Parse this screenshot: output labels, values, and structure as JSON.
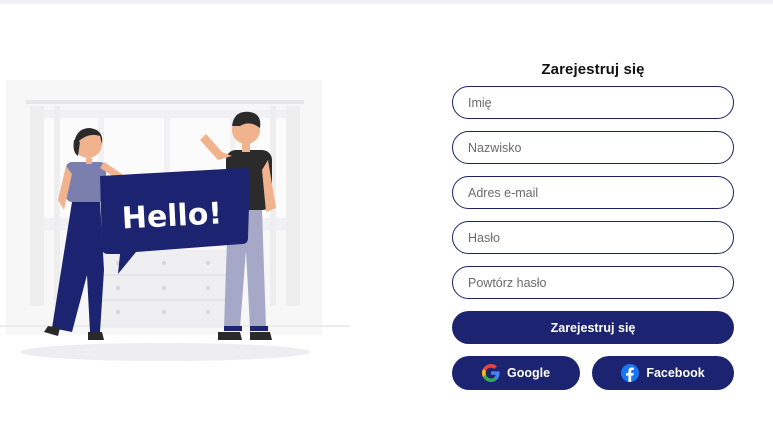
{
  "form": {
    "title": "Zarejestruj się",
    "fields": [
      {
        "placeholder": "Imię",
        "value": ""
      },
      {
        "placeholder": "Nazwisko",
        "value": ""
      },
      {
        "placeholder": "Adres e-mail",
        "value": ""
      },
      {
        "placeholder": "Hasło",
        "value": ""
      },
      {
        "placeholder": "Powtórz hasło",
        "value": ""
      }
    ],
    "submit_label": "Zarejestruj się",
    "google_label": "Google",
    "facebook_label": "Facebook"
  },
  "illustration": {
    "sign_text": "Hello!"
  },
  "colors": {
    "primary": "#1c2370",
    "field_border": "#1c2366",
    "background": "#ffffff"
  },
  "icons": {
    "google": "google-icon",
    "facebook": "facebook-icon"
  }
}
